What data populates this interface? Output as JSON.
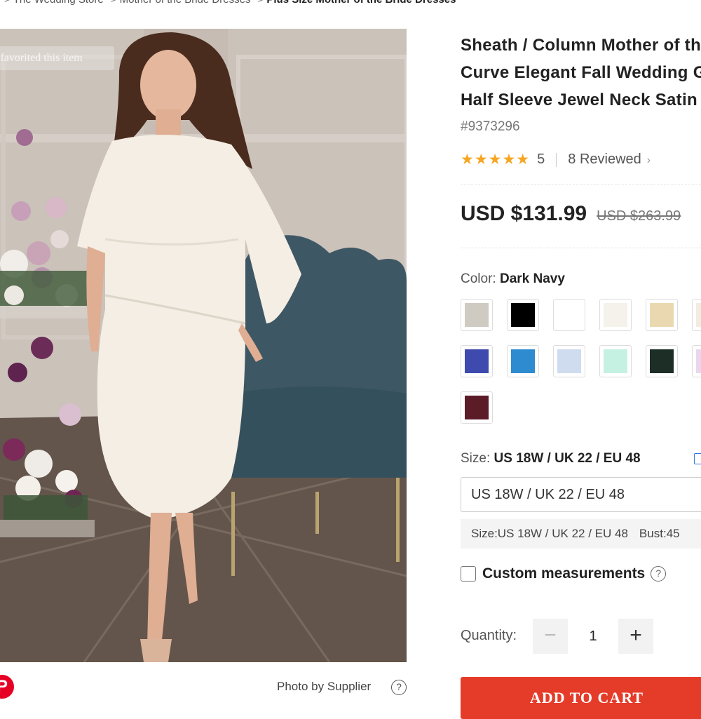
{
  "breadcrumb": [
    {
      "label": "The Wedding Store"
    },
    {
      "label": "Mother of the Bride Dresses"
    },
    {
      "label": "Plus Size Mother of the Bride Dresses"
    }
  ],
  "breadcrumb_separator": ">",
  "photo": {
    "favorite_overlay": "t favorited this item",
    "credit": "Photo by Supplier",
    "help_glyph": "?",
    "share_icon": "pinterest-icon",
    "share_glyph": "P"
  },
  "product": {
    "title_lines": [
      "Sheath / Column Mother of the Bride Dress Plus Size",
      "Curve Elegant Fall Wedding Guest Dress Jewel Neck",
      "Half Sleeve Jewel Neck Satin"
    ],
    "sku": "#9373296",
    "stars": "★★★★★",
    "rating": "5",
    "reviews": "8 Reviewed",
    "reviews_chevron": "›",
    "price": "USD $131.99",
    "original_price": "USD $263.99"
  },
  "color": {
    "label": "Color:",
    "selected": "Dark Navy",
    "swatches": [
      "#cfcbc3",
      "#000000",
      "#ffffff",
      "#f4f2ea",
      "#ead9b0",
      "#f3ece0",
      "#3f4aae",
      "#2f8bd0",
      "#cfdcf0",
      "#c5f1e3",
      "#1d2e27",
      "#e9d6ef",
      "#5b1c27"
    ]
  },
  "size": {
    "label": "Size:",
    "selected": "US 18W / UK 22 / EU 48",
    "select_value": "US 18W / UK 22 / EU 48",
    "info_size": "Size:US 18W / UK 22 / EU 48",
    "info_bust": "Bust:45"
  },
  "custom": {
    "label": "Custom measurements",
    "help_glyph": "?"
  },
  "quantity": {
    "label": "Quantity:",
    "value": "1",
    "minus": "−",
    "plus": "+"
  },
  "cart": {
    "label": "ADD TO CART"
  }
}
